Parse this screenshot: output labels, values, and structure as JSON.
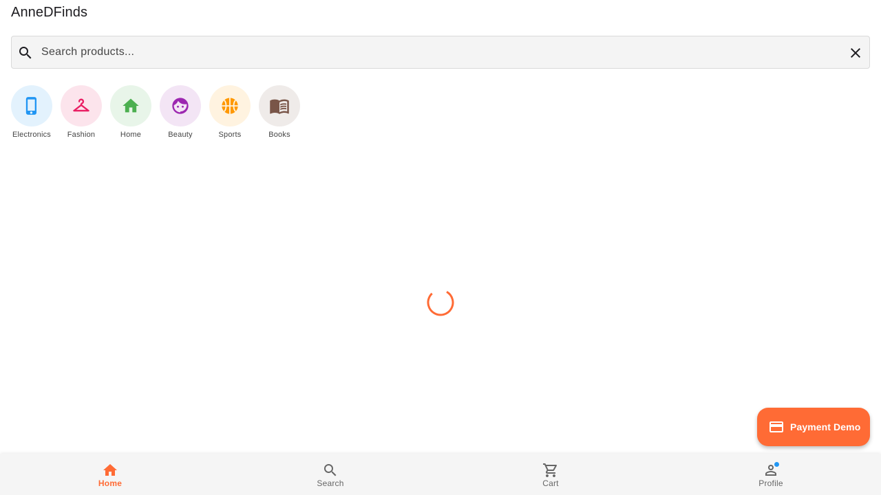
{
  "app": {
    "title": "AnneDFinds"
  },
  "search": {
    "placeholder": "Search products...",
    "value": ""
  },
  "categories": [
    {
      "label": "Electronics",
      "icon": "smartphone-icon",
      "bg": "#e3f2fd",
      "color": "#2196f3"
    },
    {
      "label": "Fashion",
      "icon": "hanger-icon",
      "bg": "#fce4ec",
      "color": "#e91e63"
    },
    {
      "label": "Home",
      "icon": "house-icon",
      "bg": "#e8f5e9",
      "color": "#4caf50"
    },
    {
      "label": "Beauty",
      "icon": "face-icon",
      "bg": "#f3e5f5",
      "color": "#9c27b0"
    },
    {
      "label": "Sports",
      "icon": "basketball-icon",
      "bg": "#fff3e0",
      "color": "#ff9800"
    },
    {
      "label": "Books",
      "icon": "book-icon",
      "bg": "#efebe9",
      "color": "#795548"
    }
  ],
  "loading": {
    "visible": true,
    "color": "#ff6b35"
  },
  "fab": {
    "label": "Payment Demo",
    "icon": "credit-card-icon",
    "color": "#ff6b35"
  },
  "bottom_nav": {
    "items": [
      {
        "label": "Home",
        "icon": "home-icon",
        "active": true
      },
      {
        "label": "Search",
        "icon": "search-icon",
        "active": false
      },
      {
        "label": "Cart",
        "icon": "cart-icon",
        "active": false
      },
      {
        "label": "Profile",
        "icon": "person-icon",
        "active": false,
        "badge_dot": true,
        "badge_color": "#2196f3"
      }
    ],
    "active_color": "#ff6b35",
    "inactive_color": "#666666"
  }
}
